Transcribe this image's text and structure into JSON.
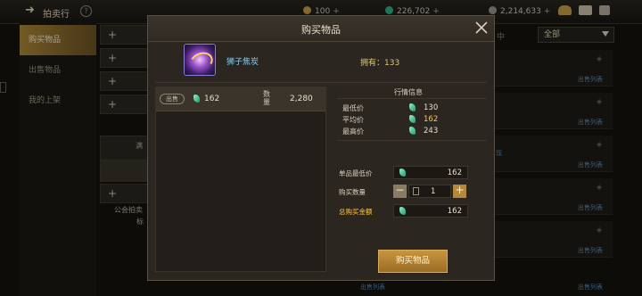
{
  "header": {
    "title": "拍卖行",
    "currencies": [
      "100",
      "226,702",
      "2,214,633"
    ]
  },
  "sidebar": {
    "items": [
      {
        "label": "购买物品"
      },
      {
        "label": "出售物品"
      },
      {
        "label": "我的上架"
      }
    ]
  },
  "categories": {
    "items": [
      "+",
      "+",
      "+",
      "+",
      "+"
    ],
    "partial_labels": [
      "满",
      "公会拍卖",
      "标"
    ]
  },
  "filter": {
    "label_partial": "中",
    "dropdown_value": "全部"
  },
  "listing": {
    "sell_list_label": "出售列表",
    "partial_text": "现"
  },
  "modal": {
    "title": "购买物品",
    "item_name": "狮子焦炭",
    "owned_label": "拥有：133",
    "list_row": {
      "badge": "出售",
      "price": "162",
      "qty_label": "数量",
      "qty_value": "2,280"
    },
    "market": {
      "title": "行情信息",
      "rows": [
        {
          "label": "最低价",
          "value": "130"
        },
        {
          "label": "平均价",
          "value": "162"
        },
        {
          "label": "最高价",
          "value": "243"
        }
      ]
    },
    "form": {
      "unit_min_label": "单品最低价",
      "unit_min_value": "162",
      "qty_label": "购买数量",
      "qty_value": "1",
      "total_label": "总购买金额",
      "total_value": "162"
    },
    "buy_button": "购买物品"
  },
  "colors": {
    "accent_gold": "#c8953f",
    "value_gold": "#ffc84a",
    "link_blue": "#5b8fb7",
    "item_name_blue": "#7fd1ff"
  }
}
